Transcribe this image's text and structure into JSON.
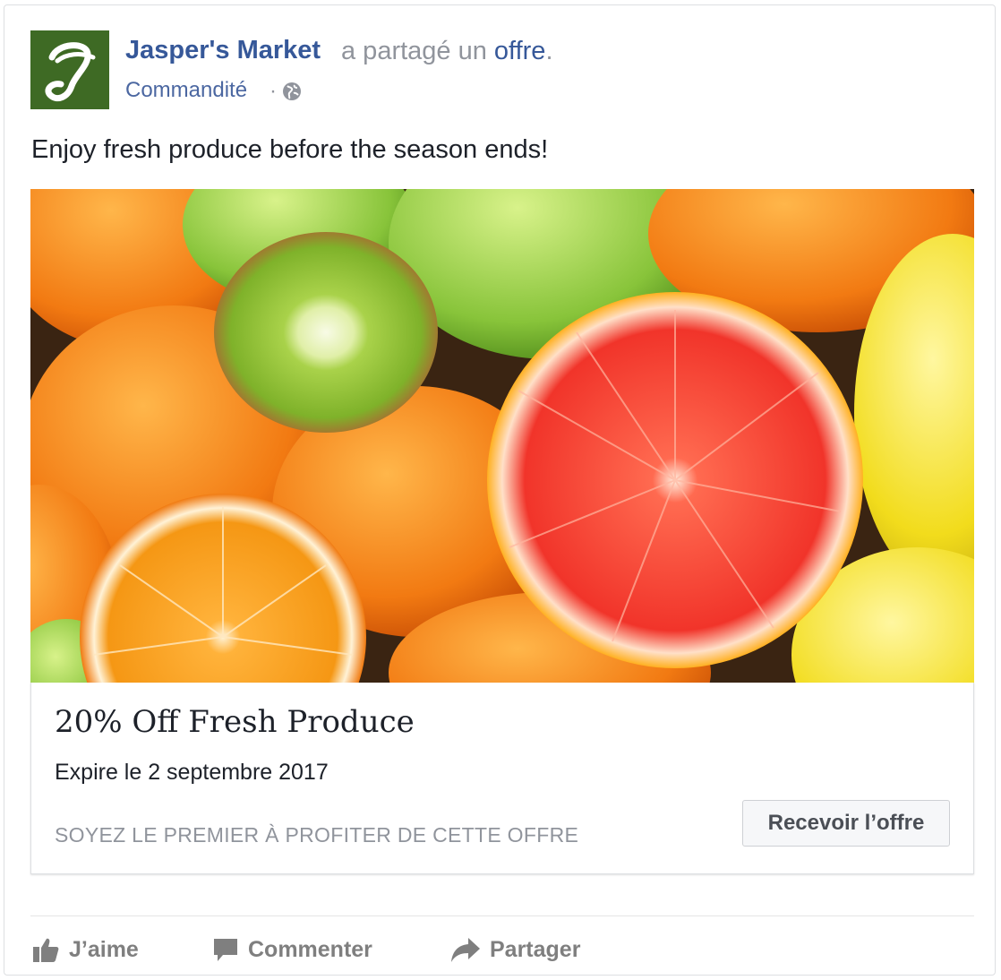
{
  "post": {
    "page_name": "Jasper's Market",
    "shared_text": "a partagé un",
    "offer_link": "offre",
    "period": ".",
    "sponsored": "Commandité",
    "separator": "·",
    "message": "Enjoy fresh produce before the season ends!"
  },
  "logo": {
    "letter": "J",
    "bg_color": "#3e6a24"
  },
  "offer": {
    "title": "20% Off Fresh Produce",
    "expiry": "Expire le 2 septembre 2017",
    "cta_text": "SOYEZ LE PREMIER À PROFITER DE CETTE OFFRE",
    "button_label": "Recevoir l’offre"
  },
  "actions": {
    "like": "J’aime",
    "comment": "Commenter",
    "share": "Partager"
  },
  "colors": {
    "link_blue": "#365899",
    "meta_gray": "#90949c",
    "action_gray": "#7f7f7f"
  },
  "icons": {
    "audience": "globe-icon",
    "like": "thumbs-up-icon",
    "comment": "comment-icon",
    "share": "share-arrow-icon"
  }
}
